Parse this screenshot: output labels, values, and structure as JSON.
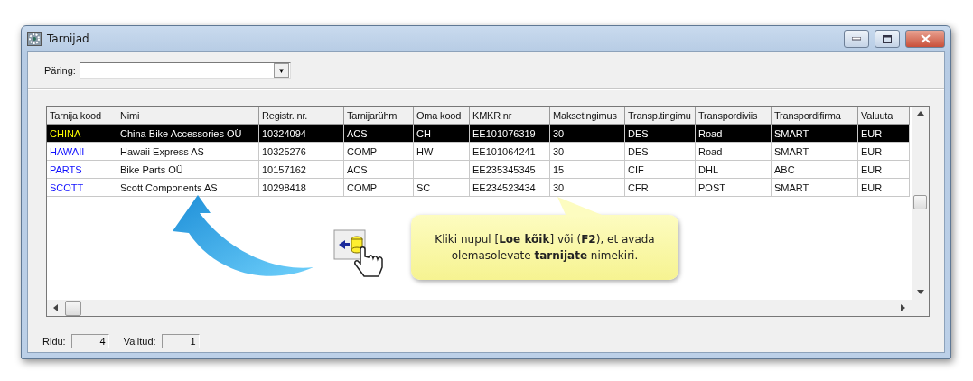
{
  "window": {
    "title": "Tarnijad"
  },
  "query": {
    "label": "Päring:",
    "button": "▼"
  },
  "table": {
    "columns": [
      "Tarnija kood",
      "Nimi",
      "Registr. nr.",
      "Tarnijarühm",
      "Oma kood",
      "KMKR nr",
      "Maksetingimus",
      "Transp.tingimu",
      "Transpordiviis",
      "Transpordifirma",
      "Valuuta"
    ],
    "rows": [
      {
        "selected": true,
        "cells": [
          "CHINA",
          "China Bike Accessories OÜ",
          "10324094",
          "ACS",
          "CH",
          "EE101076319",
          "30",
          "DES",
          "Road",
          "SMART",
          "EUR"
        ]
      },
      {
        "selected": false,
        "cells": [
          "HAWAII",
          "Hawaii Express AS",
          "10325276",
          "COMP",
          "HW",
          "EE101064241",
          "30",
          "DES",
          "Road",
          "SMART",
          "EUR"
        ]
      },
      {
        "selected": false,
        "cells": [
          "PARTS",
          "Bike Parts OÜ",
          "10157162",
          "ACS",
          "",
          "EE235345345",
          "15",
          "CIF",
          "DHL",
          "ABC",
          "EUR"
        ]
      },
      {
        "selected": false,
        "cells": [
          "SCOTT",
          "Scott Components AS",
          "10298418",
          "COMP",
          "SC",
          "EE234523434",
          "30",
          "CFR",
          "POST",
          "SMART",
          "EUR"
        ]
      }
    ]
  },
  "callout": {
    "text": "Kliki nupul [**Loe kõik**] või (**F2**), et avada olemasolevate **tarnijate** nimekiri."
  },
  "status_bar": {
    "rows_label": "Ridu:",
    "rows_value": "4",
    "selected_label": "Valitud:",
    "selected_value": "1"
  }
}
